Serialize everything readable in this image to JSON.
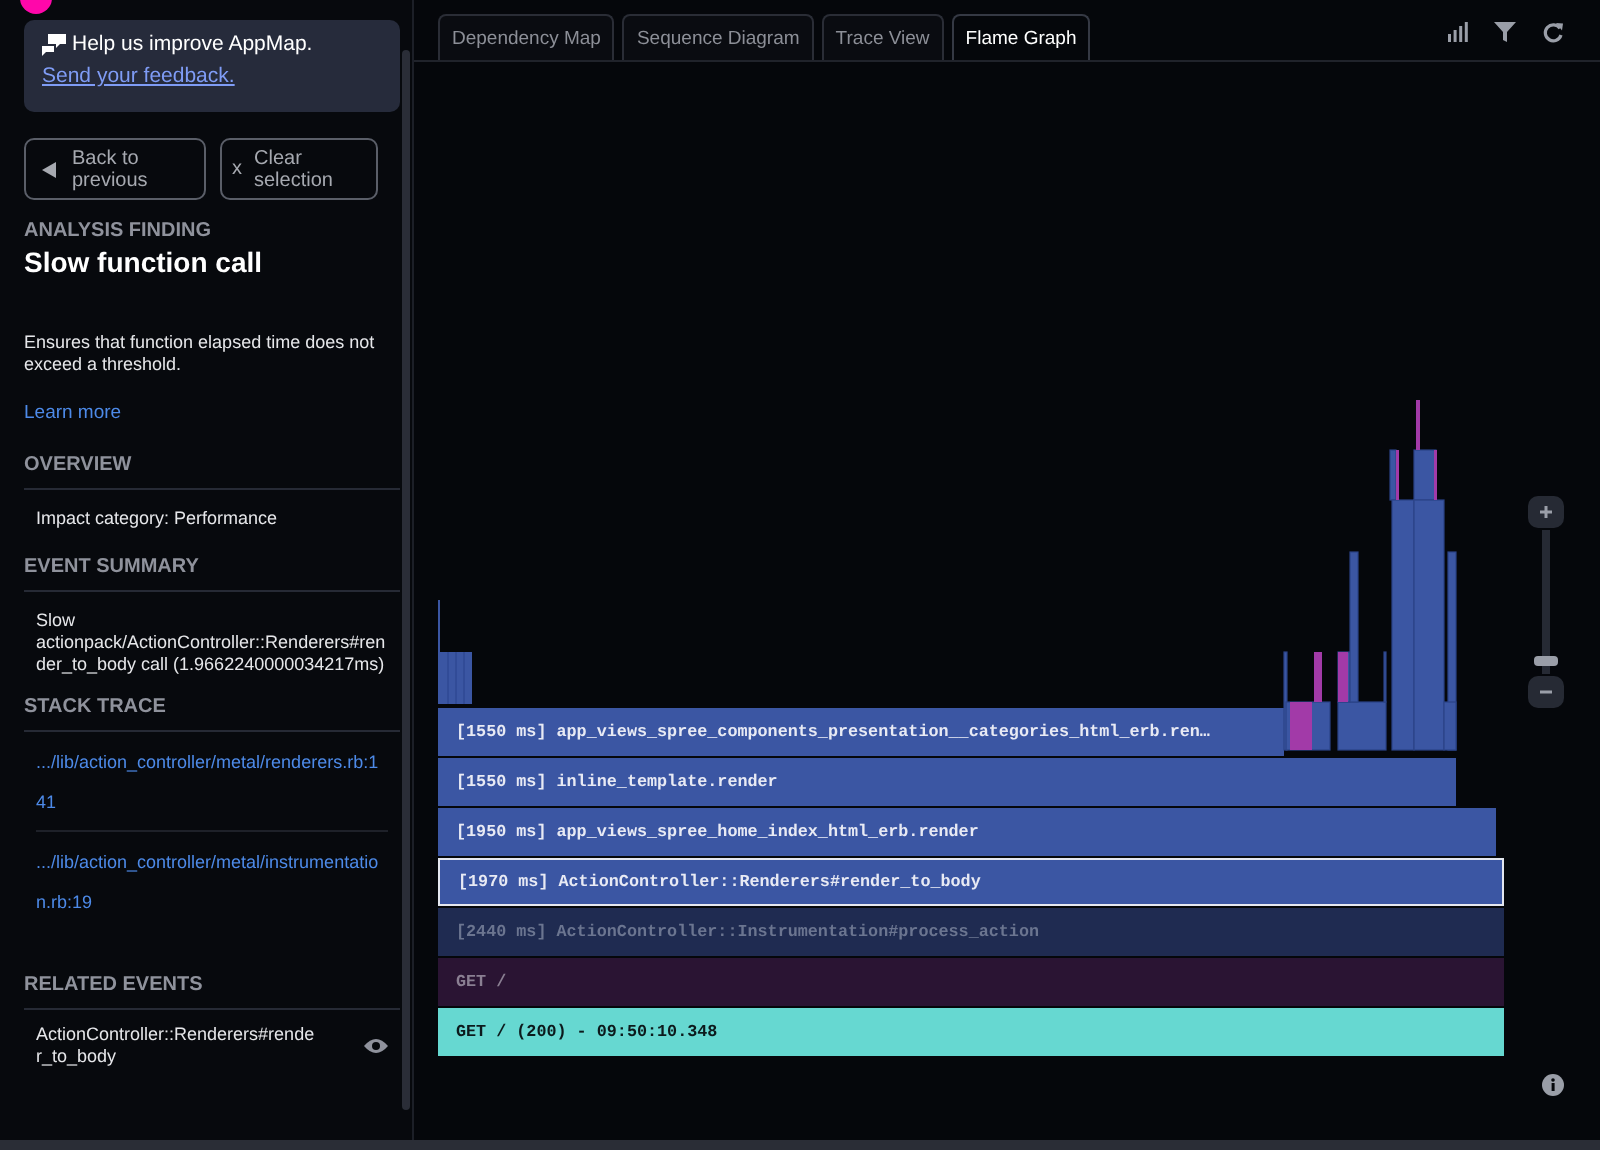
{
  "feedback": {
    "title": "Help us improve AppMap.",
    "link": "Send your feedback."
  },
  "nav_buttons": [
    {
      "kind": "back",
      "label": "Back to previous"
    },
    {
      "kind": "clear",
      "glyph": "x",
      "label": "Clear selection"
    }
  ],
  "finding": {
    "heading": "ANALYSIS FINDING",
    "title": "Slow function call",
    "description": "Ensures that function elapsed time does not exceed a threshold.",
    "link": "Learn more"
  },
  "overview": {
    "heading": "OVERVIEW",
    "items": [
      "Impact category: Performance"
    ]
  },
  "event_summary": {
    "heading": "EVENT SUMMARY",
    "text": "Slow actionpack/ActionController::Renderers#render_to_body call (1.9662240000034217ms)"
  },
  "stack_trace": {
    "heading": "STACK TRACE",
    "items": [
      ".../lib/action_controller/metal/renderers.rb:141",
      ".../lib/action_controller/metal/instrumentation.rb:19"
    ]
  },
  "related_events": {
    "heading": "RELATED EVENTS",
    "items": [
      {
        "label": "ActionController::Renderers#render_to_body"
      }
    ]
  },
  "tabs": [
    {
      "label": "Dependency Map",
      "selected": false
    },
    {
      "label": "Sequence Diagram",
      "selected": false
    },
    {
      "label": "Trace View",
      "selected": false
    },
    {
      "label": "Flame Graph",
      "selected": true
    }
  ],
  "flame_graph": {
    "frames": [
      {
        "kind": "call",
        "label": "[1550 ms] app_views_spree_components_presentation__categories_html_erb.ren…",
        "selected": false
      },
      {
        "kind": "call",
        "label": "[1550 ms] inline_template.render",
        "selected": false
      },
      {
        "kind": "call",
        "label": "[1950 ms] app_views_spree_home_index_html_erb.render",
        "selected": false
      },
      {
        "kind": "call",
        "label": "[1970 ms] ActionController::Renderers#render_to_body",
        "selected": true
      },
      {
        "kind": "dimmed",
        "label": "[2440 ms] ActionController::Instrumentation#process_action",
        "selected": false
      },
      {
        "kind": "request",
        "label": "GET /",
        "selected": false
      },
      {
        "kind": "root",
        "label": "GET / (200) - 09:50:10.348",
        "selected": false
      }
    ],
    "zoom": {
      "level": 0.05
    }
  }
}
